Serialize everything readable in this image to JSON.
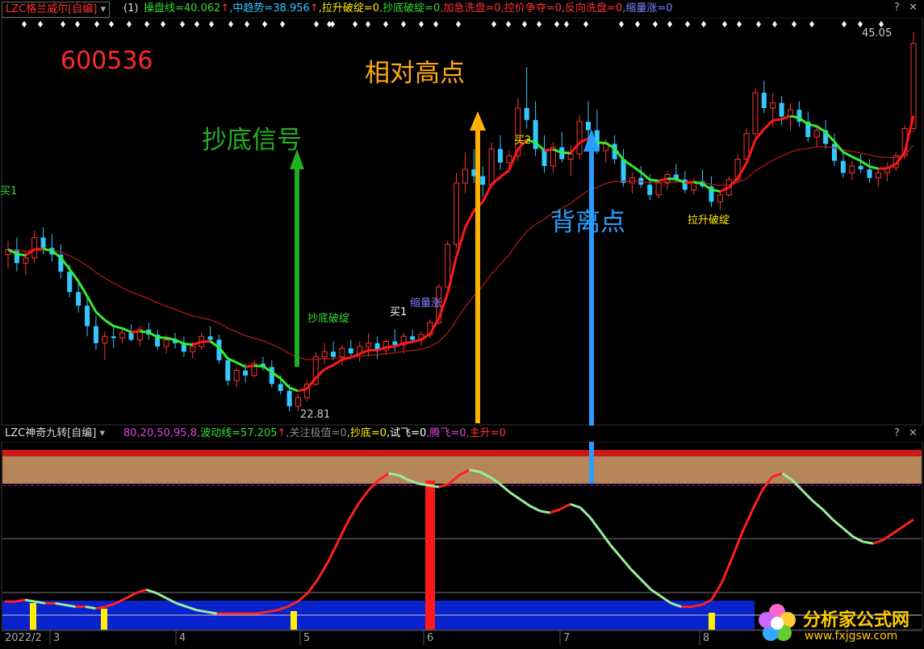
{
  "top_panel": {
    "indicator_name": "LZC格兰威尔[自编]",
    "param": "(1)",
    "readouts": [
      {
        "text": "操盘线=40.062",
        "color": "#33dd33"
      },
      {
        "text": "↑",
        "color": "#ff3333"
      },
      {
        "text": ",中趋势=38.956",
        "color": "#33c9ff"
      },
      {
        "text": "↑",
        "color": "#ff3333"
      },
      {
        "text": ",拉升破绽=0",
        "color": "#ffee00"
      },
      {
        "text": ",抄底破绽=0",
        "color": "#33dd33"
      },
      {
        "text": ",加急洗盘=0",
        "color": "#ff3333"
      },
      {
        "text": ",控价争夺=0",
        "color": "#ff3333"
      },
      {
        "text": ",反向洗盘=0",
        "color": "#ff3333"
      },
      {
        "text": ",缩量涨=0",
        "color": "#7f7fff"
      }
    ],
    "stock_code": "600536",
    "annotation_bottom": "抄底信号",
    "annotation_high": "相对高点",
    "annotation_divergence": "背离点",
    "high_price_label": "45.05",
    "low_price_label": "22.81",
    "signal_labels": [
      "抄底破绽",
      "买1",
      "缩量涨",
      "买2",
      "拉升破绽",
      "买1"
    ],
    "colors": {
      "up": "#ff3333",
      "down": "#33c9ff",
      "flat": "#ffffff",
      "ma_green": "#33ee33",
      "ma_red": "#ff1a1a"
    }
  },
  "bottom_panel": {
    "indicator_name": "LZC神奇九转[自编]",
    "readouts": [
      {
        "text": "80,20,50,95,8,",
        "color": "#dd44dd"
      },
      {
        "text": "波动线=57.205",
        "color": "#33dd33"
      },
      {
        "text": "↑",
        "color": "#ff3333"
      },
      {
        "text": ",关注极值=0",
        "color": "#888888"
      },
      {
        "text": ",抄底=0",
        "color": "#ffee00"
      },
      {
        "text": ",试飞=0",
        "color": "#ffffff"
      },
      {
        "text": ",腾飞=0",
        "color": "#dd44dd"
      },
      {
        "text": ",主升=0",
        "color": "#ff3333"
      }
    ],
    "x_axis_labels": [
      "2022/2",
      "3",
      "4",
      "5",
      "6",
      "7",
      "8"
    ],
    "count_up_color": "#ffffff",
    "count_down_color": "#dd44dd"
  },
  "watermark": {
    "title": "分析家公式网",
    "url": "www.fxjgsw.com"
  },
  "chart_data": {
    "type": "candlestick",
    "symbol": "600536",
    "ylim": [
      22.81,
      45.05
    ],
    "candles": [
      [
        32,
        32.8,
        31.2,
        32.3
      ],
      [
        32.3,
        33.0,
        31.0,
        31.5
      ],
      [
        31.5,
        32.2,
        30.8,
        31.8
      ],
      [
        31.8,
        33.4,
        31.5,
        33.0
      ],
      [
        33.0,
        33.6,
        32.0,
        32.4
      ],
      [
        32.4,
        33.2,
        31.6,
        32.0
      ],
      [
        32.0,
        32.6,
        30.6,
        31.0
      ],
      [
        31.0,
        31.4,
        29.5,
        29.8
      ],
      [
        29.8,
        30.4,
        28.6,
        29.0
      ],
      [
        29.0,
        29.5,
        27.2,
        27.8
      ],
      [
        27.8,
        28.4,
        26.4,
        26.8
      ],
      [
        26.8,
        27.5,
        25.8,
        27.2
      ],
      [
        27.2,
        27.8,
        26.5,
        27.1
      ],
      [
        27.1,
        27.6,
        26.8,
        27.4
      ],
      [
        27.4,
        27.9,
        26.9,
        27.0
      ],
      [
        27.0,
        27.8,
        26.6,
        27.6
      ],
      [
        27.6,
        28.0,
        27.0,
        27.3
      ],
      [
        27.3,
        27.6,
        26.4,
        26.6
      ],
      [
        26.6,
        27.3,
        26.2,
        27.0
      ],
      [
        27.0,
        27.4,
        26.5,
        26.8
      ],
      [
        26.8,
        27.2,
        26.0,
        26.3
      ],
      [
        26.3,
        26.9,
        25.9,
        26.6
      ],
      [
        26.6,
        27.4,
        26.4,
        27.2
      ],
      [
        27.2,
        27.8,
        26.8,
        27.0
      ],
      [
        27.0,
        27.3,
        25.6,
        25.8
      ],
      [
        25.8,
        26.0,
        24.3,
        24.6
      ],
      [
        24.6,
        25.4,
        24.2,
        25.2
      ],
      [
        25.2,
        25.6,
        24.5,
        24.9
      ],
      [
        24.9,
        25.8,
        24.8,
        25.6
      ],
      [
        25.6,
        26.0,
        25.2,
        25.4
      ],
      [
        25.4,
        25.8,
        24.2,
        24.4
      ],
      [
        24.4,
        24.9,
        23.8,
        24.0
      ],
      [
        24.0,
        24.4,
        22.8,
        23.1
      ],
      [
        23.1,
        23.8,
        22.81,
        23.6
      ],
      [
        23.6,
        24.6,
        23.4,
        24.4
      ],
      [
        24.4,
        26.3,
        24.3,
        26.0
      ],
      [
        26.0,
        26.8,
        25.6,
        26.3
      ],
      [
        26.3,
        26.9,
        25.8,
        26.0
      ],
      [
        26.0,
        26.7,
        25.5,
        26.5
      ],
      [
        26.5,
        27.0,
        25.9,
        26.2
      ],
      [
        26.2,
        26.9,
        25.7,
        26.6
      ],
      [
        26.6,
        27.4,
        26.0,
        26.8
      ],
      [
        26.8,
        27.2,
        25.9,
        26.4
      ],
      [
        26.4,
        27.0,
        26.1,
        26.9
      ],
      [
        26.9,
        27.6,
        26.3,
        26.7
      ],
      [
        26.7,
        27.4,
        26.2,
        27.2
      ],
      [
        27.2,
        27.6,
        26.8,
        27.0
      ],
      [
        27.0,
        27.5,
        26.6,
        27.3
      ],
      [
        27.3,
        28.2,
        27.1,
        28.0
      ],
      [
        28.0,
        30.3,
        27.9,
        30.1
      ],
      [
        30.1,
        32.8,
        30.0,
        32.6
      ],
      [
        32.6,
        36.8,
        32.4,
        36.2
      ],
      [
        36.2,
        38.0,
        35.6,
        37.0
      ],
      [
        37.0,
        38.2,
        36.2,
        36.6
      ],
      [
        36.6,
        37.2,
        35.4,
        36.1
      ],
      [
        36.1,
        38.6,
        36.0,
        38.2
      ],
      [
        38.2,
        39.0,
        37.0,
        37.4
      ],
      [
        37.4,
        38.1,
        36.8,
        37.8
      ],
      [
        37.8,
        41.2,
        37.5,
        40.6
      ],
      [
        40.6,
        43.0,
        39.4,
        39.9
      ],
      [
        39.9,
        41.0,
        37.8,
        38.2
      ],
      [
        38.2,
        39.0,
        36.8,
        37.2
      ],
      [
        37.2,
        38.6,
        36.8,
        38.3
      ],
      [
        38.3,
        39.2,
        37.4,
        37.6
      ],
      [
        37.6,
        38.4,
        36.6,
        37.9
      ],
      [
        37.9,
        40.2,
        37.6,
        39.8
      ],
      [
        39.8,
        41.0,
        38.7,
        39.3
      ],
      [
        39.3,
        40.5,
        37.9,
        38.1
      ],
      [
        38.1,
        38.8,
        37.4,
        38.5
      ],
      [
        38.5,
        39.0,
        37.3,
        37.6
      ],
      [
        37.6,
        38.2,
        36.0,
        36.2
      ],
      [
        36.2,
        36.8,
        35.6,
        36.5
      ],
      [
        36.5,
        37.2,
        35.9,
        36.1
      ],
      [
        36.1,
        36.7,
        35.2,
        35.5
      ],
      [
        35.5,
        36.4,
        35.3,
        36.2
      ],
      [
        36.2,
        36.9,
        35.8,
        36.7
      ],
      [
        36.7,
        37.3,
        36.2,
        36.4
      ],
      [
        36.4,
        36.9,
        35.6,
        35.8
      ],
      [
        35.8,
        36.5,
        35.5,
        36.3
      ],
      [
        36.3,
        37.0,
        35.9,
        36.0
      ],
      [
        36.0,
        36.6,
        34.8,
        35.1
      ],
      [
        35.1,
        35.8,
        34.6,
        35.5
      ],
      [
        35.5,
        36.6,
        35.4,
        36.4
      ],
      [
        36.4,
        37.9,
        36.2,
        37.6
      ],
      [
        37.6,
        39.4,
        37.4,
        39.1
      ],
      [
        39.1,
        41.8,
        38.9,
        41.5
      ],
      [
        41.5,
        42.2,
        40.3,
        40.6
      ],
      [
        40.6,
        41.5,
        39.5,
        40.9
      ],
      [
        40.9,
        41.3,
        39.6,
        40.1
      ],
      [
        40.1,
        40.9,
        39.3,
        40.5
      ],
      [
        40.5,
        41.0,
        39.5,
        39.8
      ],
      [
        39.8,
        40.4,
        38.6,
        38.9
      ],
      [
        38.9,
        39.6,
        38.3,
        39.3
      ],
      [
        39.3,
        39.9,
        38.2,
        38.5
      ],
      [
        38.5,
        39.1,
        37.2,
        37.5
      ],
      [
        37.5,
        38.0,
        36.5,
        36.8
      ],
      [
        36.8,
        37.5,
        36.4,
        37.2
      ],
      [
        37.2,
        37.9,
        36.8,
        37.0
      ],
      [
        37.0,
        37.6,
        36.2,
        36.5
      ],
      [
        36.5,
        37.1,
        36.0,
        36.8
      ],
      [
        36.8,
        37.4,
        36.3,
        37.1
      ],
      [
        37.1,
        38.0,
        36.9,
        37.8
      ],
      [
        37.8,
        39.6,
        37.6,
        39.4
      ],
      [
        39.4,
        45.05,
        39.2,
        44.4
      ]
    ],
    "count_series": [
      15,
      15,
      16,
      15,
      14,
      14,
      13,
      12,
      12,
      11,
      12,
      14,
      17,
      20,
      22,
      20,
      17,
      14,
      12,
      10,
      9,
      8,
      8,
      8,
      8,
      8,
      9,
      10,
      12,
      15,
      20,
      28,
      38,
      50,
      62,
      72,
      80,
      86,
      90,
      89,
      86,
      84,
      83,
      82,
      84,
      89,
      92,
      91,
      88,
      84,
      79,
      75,
      71,
      68,
      67,
      69,
      72,
      70,
      64,
      56,
      48,
      41,
      34,
      28,
      22,
      18,
      14,
      12,
      12,
      13,
      16,
      26,
      40,
      55,
      68,
      80,
      88,
      90,
      86,
      80,
      74,
      69,
      63,
      58,
      53,
      50,
      49,
      51,
      55,
      59,
      63
    ]
  }
}
